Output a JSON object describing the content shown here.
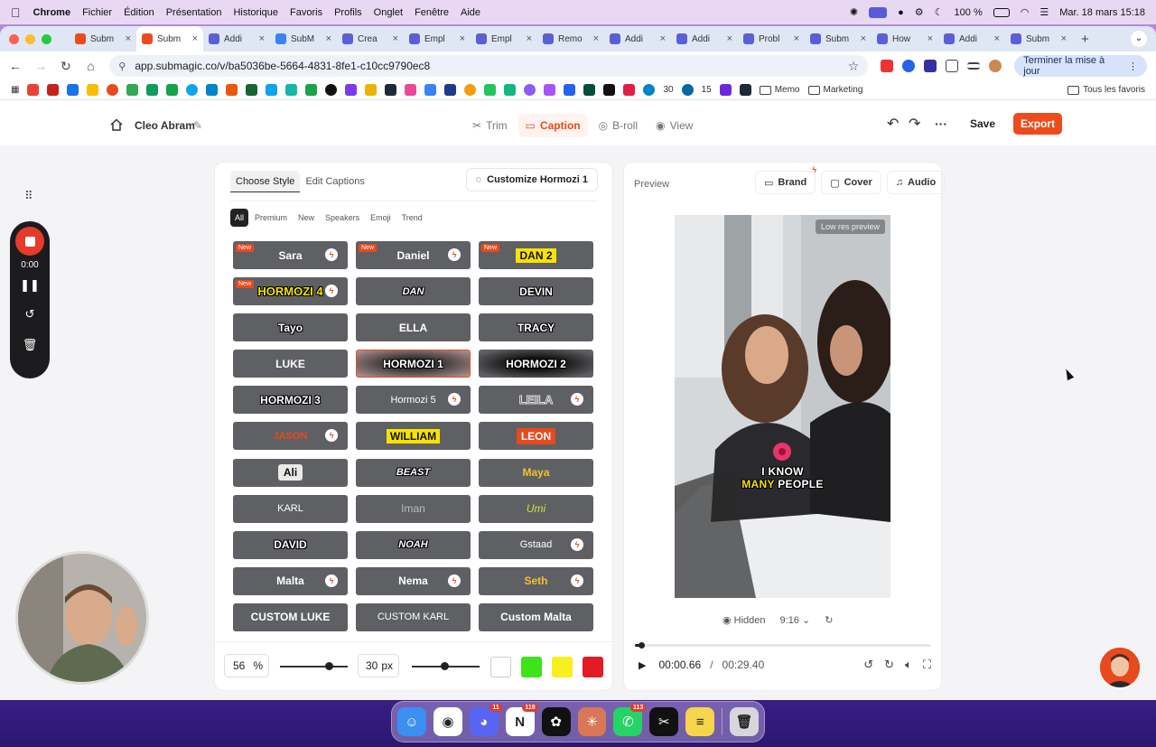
{
  "menubar": {
    "app": "Chrome",
    "items": [
      "Fichier",
      "Édition",
      "Présentation",
      "Historique",
      "Favoris",
      "Profils",
      "Onglet",
      "Fenêtre",
      "Aide"
    ],
    "battery": "100 %",
    "datetime": "Mar. 18 mars  15:18"
  },
  "tabs": [
    {
      "label": "Subm",
      "color": "#ee4b1c"
    },
    {
      "label": "Subm",
      "color": "#ee4b1c",
      "active": true
    },
    {
      "label": "Addi",
      "color": "#5b5fd6"
    },
    {
      "label": "SubM",
      "color": "#3b82f6"
    },
    {
      "label": "Crea",
      "color": "#5b5fd6"
    },
    {
      "label": "Empl",
      "color": "#5b5fd6"
    },
    {
      "label": "Empl",
      "color": "#5b5fd6"
    },
    {
      "label": "Remo",
      "color": "#5b5fd6"
    },
    {
      "label": "Addi",
      "color": "#5b5fd6"
    },
    {
      "label": "Addi",
      "color": "#5b5fd6"
    },
    {
      "label": "Probl",
      "color": "#5b5fd6"
    },
    {
      "label": "Subm",
      "color": "#5b5fd6"
    },
    {
      "label": "How",
      "color": "#5b5fd6"
    },
    {
      "label": "Addi",
      "color": "#5b5fd6"
    },
    {
      "label": "Subm",
      "color": "#5b5fd6"
    }
  ],
  "address": {
    "url": "app.submagic.co/v/ba5036be-5664-4831-8fe1-c10cc9790ec8",
    "update_btn": "Terminer la mise à jour"
  },
  "bookmarks": {
    "count1": "30",
    "count2": "15",
    "folder1": "Memo",
    "folder2": "Marketing",
    "all": "Tous les favoris"
  },
  "header": {
    "project": "Cleo Abram",
    "modes": [
      {
        "label": "Trim",
        "icon": "scissors-icon"
      },
      {
        "label": "Caption",
        "icon": "caption-icon",
        "active": true
      },
      {
        "label": "B-roll",
        "icon": "broll-icon"
      },
      {
        "label": "View",
        "icon": "eye-icon"
      }
    ],
    "save": "Save",
    "export": "Export"
  },
  "captions": {
    "tab_choose": "Choose Style",
    "tab_edit": "Edit Captions",
    "customize": "Customize Hormozi 1",
    "filters": [
      "All",
      "Premium",
      "New",
      "Speakers",
      "Emoji",
      "Trend"
    ],
    "styles": [
      {
        "label": "Sara",
        "badge": "New",
        "bolt": true,
        "cls": "serif"
      },
      {
        "label": "Daniel",
        "badge": "New",
        "bolt": true,
        "cls": "plain"
      },
      {
        "label": "DAN 2",
        "badge": "New",
        "bolt": false,
        "cls": "yellow"
      },
      {
        "label": "HORMOZI 4",
        "badge": "New",
        "bolt": true,
        "cls": "h4"
      },
      {
        "label": "DAN",
        "badge": "",
        "bolt": false,
        "cls": "italic"
      },
      {
        "label": "DEVIN",
        "badge": "",
        "bolt": false,
        "cls": "shadow"
      },
      {
        "label": "Tayo",
        "badge": "",
        "bolt": false,
        "cls": "shadow"
      },
      {
        "label": "ELLA",
        "badge": "",
        "bolt": false,
        "cls": "plain"
      },
      {
        "label": "TRACY",
        "badge": "",
        "bolt": false,
        "cls": "shadow"
      },
      {
        "label": "LUKE",
        "badge": "",
        "bolt": false,
        "cls": "plain"
      },
      {
        "label": "HORMOZI 1",
        "badge": "",
        "bolt": false,
        "cls": "selected"
      },
      {
        "label": "HORMOZI 2",
        "badge": "",
        "bolt": false,
        "cls": "glow"
      },
      {
        "label": "HORMOZI 3",
        "badge": "",
        "bolt": false,
        "cls": "shadow"
      },
      {
        "label": "Hormozi 5",
        "badge": "",
        "bolt": true,
        "cls": "thin"
      },
      {
        "label": "LEILA",
        "badge": "",
        "bolt": true,
        "cls": "outline"
      },
      {
        "label": "JASON",
        "badge": "",
        "bolt": true,
        "cls": "red"
      },
      {
        "label": "WILLIAM",
        "badge": "",
        "bolt": false,
        "cls": "yellow"
      },
      {
        "label": "LEON",
        "badge": "",
        "bolt": false,
        "cls": "orange"
      },
      {
        "label": "Ali",
        "badge": "",
        "bolt": false,
        "cls": "gray"
      },
      {
        "label": "BEAST",
        "badge": "",
        "bolt": false,
        "cls": "italic"
      },
      {
        "label": "Maya",
        "badge": "",
        "bolt": false,
        "cls": "gold"
      },
      {
        "label": "KARL",
        "badge": "",
        "bolt": false,
        "cls": "thin"
      },
      {
        "label": "Iman",
        "badge": "",
        "bolt": false,
        "cls": "muted"
      },
      {
        "label": "Umi",
        "badge": "",
        "bolt": false,
        "cls": "lime"
      },
      {
        "label": "DAVID",
        "badge": "",
        "bolt": false,
        "cls": "shadow"
      },
      {
        "label": "NOAH",
        "badge": "",
        "bolt": false,
        "cls": "italic"
      },
      {
        "label": "Gstaad",
        "badge": "",
        "bolt": true,
        "cls": "thin"
      },
      {
        "label": "Malta",
        "badge": "",
        "bolt": true,
        "cls": "plain"
      },
      {
        "label": "Nema",
        "badge": "",
        "bolt": true,
        "cls": "plain"
      },
      {
        "label": "Seth",
        "badge": "",
        "bolt": true,
        "cls": "gold"
      },
      {
        "label": "CUSTOM LUKE",
        "badge": "",
        "bolt": false,
        "cls": "plain"
      },
      {
        "label": "CUSTOM KARL",
        "badge": "",
        "bolt": false,
        "cls": "thin"
      },
      {
        "label": "Custom Malta",
        "badge": "",
        "bolt": false,
        "cls": "plain"
      }
    ],
    "size_value": "56",
    "size_unit": "%",
    "size_level": 0.72,
    "stroke_value": "30",
    "stroke_unit": "px",
    "stroke_level": 0.48,
    "colors": [
      "#ffffff",
      "#3ee31a",
      "#f7f01e",
      "#e31b23"
    ]
  },
  "preview": {
    "label": "Preview",
    "brand": "Brand",
    "cover": "Cover",
    "audio": "Audio",
    "lowres": "Low res preview",
    "caption_line1": "I KNOW",
    "caption_hl": "MANY",
    "caption_rest": "PEOPLE",
    "hidden": "Hidden",
    "ratio": "9:16",
    "current": "00:00.66",
    "separator": "/",
    "total": "00:29.40",
    "progress": 0.022
  },
  "recorder": {
    "time": "0:00"
  },
  "dock": [
    {
      "name": "finder",
      "color": "#3b8ff0",
      "badge": ""
    },
    {
      "name": "chrome",
      "color": "#ffffff",
      "badge": ""
    },
    {
      "name": "discord",
      "color": "#5865f2",
      "badge": "11"
    },
    {
      "name": "notion",
      "color": "#ffffff",
      "badge": "118"
    },
    {
      "name": "chatgpt",
      "color": "#111111",
      "badge": ""
    },
    {
      "name": "claude",
      "color": "#d97757",
      "badge": ""
    },
    {
      "name": "whatsapp",
      "color": "#25d366",
      "badge": "113"
    },
    {
      "name": "capcut",
      "color": "#111111",
      "badge": ""
    },
    {
      "name": "notes",
      "color": "#f5d54a",
      "badge": ""
    },
    {
      "name": "trash",
      "color": "#d6d6dc",
      "badge": ""
    }
  ]
}
